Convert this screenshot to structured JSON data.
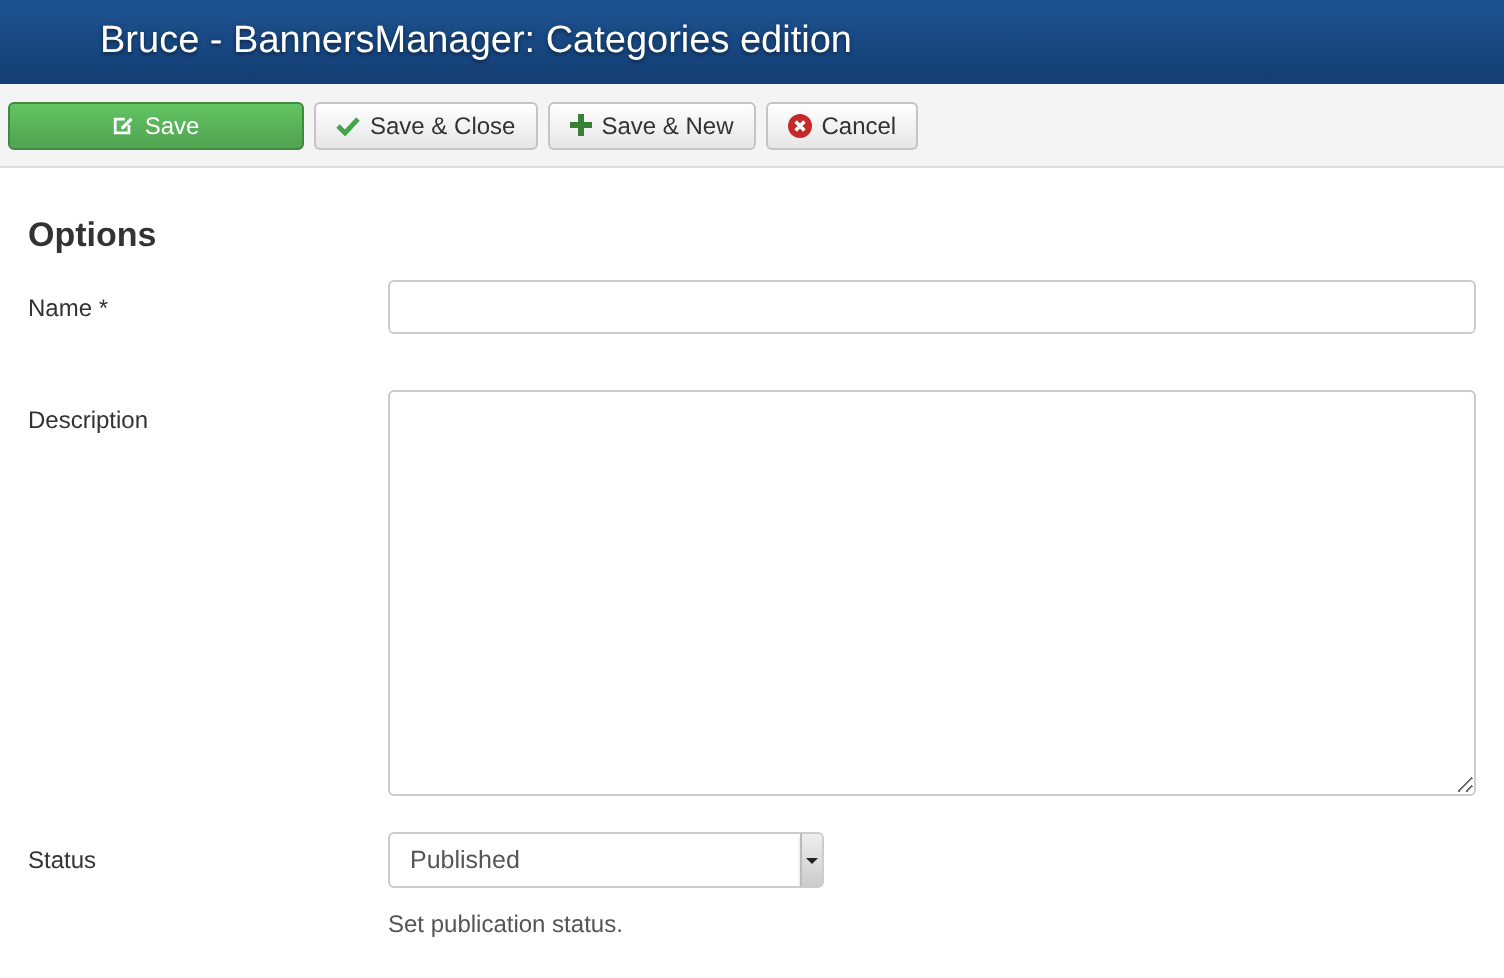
{
  "header": {
    "title": "Bruce - BannersManager: Categories edition"
  },
  "toolbar": [
    {
      "label": "Save",
      "kind": "save"
    },
    {
      "label": "Save & Close",
      "kind": "save-close"
    },
    {
      "label": "Save & New",
      "kind": "save-new"
    },
    {
      "label": "Cancel",
      "kind": "cancel"
    }
  ],
  "section": {
    "title": "Options"
  },
  "fields": [
    {
      "label": "Name *",
      "kind": "text"
    },
    {
      "label": "Description",
      "kind": "textarea"
    },
    {
      "label": "Status",
      "kind": "select",
      "value": "Published",
      "help": "Set publication status."
    }
  ]
}
